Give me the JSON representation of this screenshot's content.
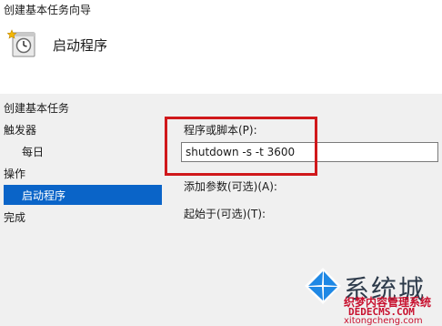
{
  "window": {
    "title": "创建基本任务向导"
  },
  "header": {
    "heading": "启动程序",
    "icon": "task-scheduler-clock-icon"
  },
  "steps": {
    "items": [
      {
        "label": "创建基本任务"
      },
      {
        "label": "触发器"
      },
      {
        "label": "每日"
      },
      {
        "label": "操作"
      },
      {
        "label": "启动程序",
        "selected": true
      },
      {
        "label": "完成"
      }
    ]
  },
  "form": {
    "program_label": "程序或脚本(P):",
    "program_value": "shutdown -s -t 3600",
    "args_label": "添加参数(可选)(A):",
    "start_in_label": "起始于(可选)(T):"
  },
  "watermark": {
    "main": "系统城",
    "sub1": "织梦内容管理系统",
    "sub2": "DEDECMS.COM",
    "sub3": "xitongcheng.com"
  },
  "colors": {
    "selected_step": "#0a64c8",
    "highlight_box": "#d0181b",
    "content_bg": "#f0f0f0"
  }
}
